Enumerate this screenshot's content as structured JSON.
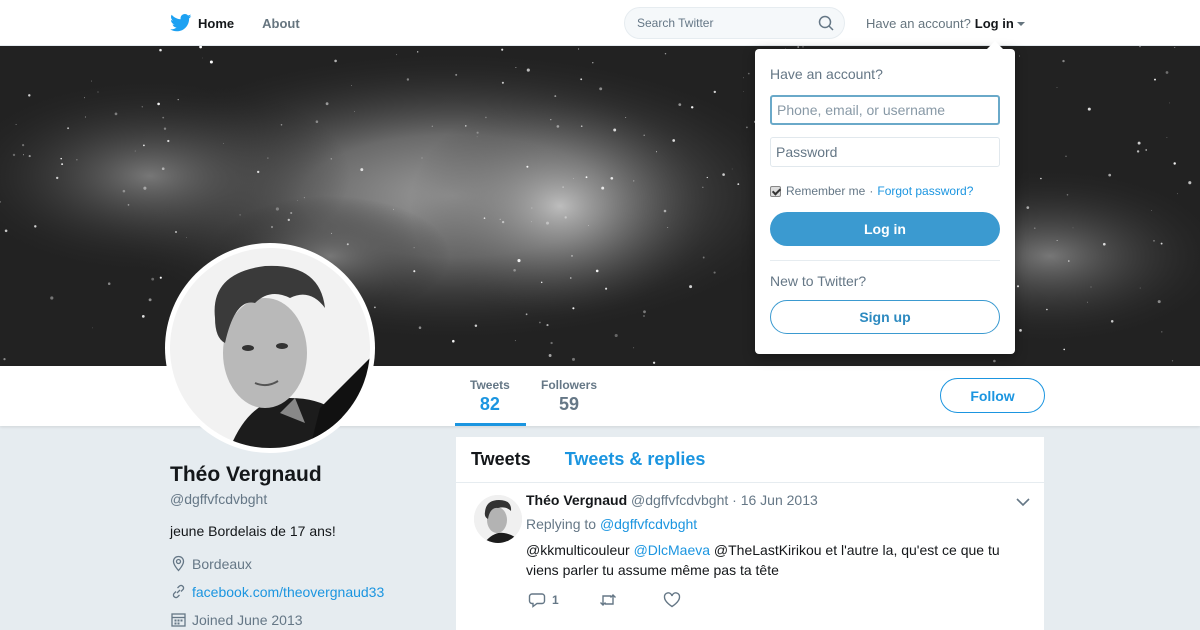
{
  "nav": {
    "home_label": "Home",
    "about_label": "About",
    "search_placeholder": "Search Twitter",
    "have_account": "Have an account?",
    "login_label": "Log in"
  },
  "profile": {
    "name": "Théo Vergnaud",
    "handle": "@dgffvfcdvbght",
    "bio": "jeune Bordelais de 17 ans!",
    "location": "Bordeaux",
    "website": "facebook.com/theovergnaud33",
    "joined": "Joined June 2013"
  },
  "stats": [
    {
      "label": "Tweets",
      "value": "82"
    },
    {
      "label": "Followers",
      "value": "59"
    }
  ],
  "follow_label": "Follow",
  "timeline": {
    "tabs": [
      "Tweets",
      "Tweets & replies"
    ],
    "tweet": {
      "name": "Théo Vergnaud",
      "handle": "@dgffvfcdvbght",
      "dot": "·",
      "date": "16 Jun 2013",
      "replying_to": "Replying to",
      "reply_handle": "@dgffvfcdvbght",
      "text_part1": "@kkmulticouleur",
      "mention": "@DlcMaeva",
      "text_part2": "@TheLastKirikou et l'autre la, qu'est ce que tu viens parler tu assume même pas ta tête",
      "reply_count": "1"
    }
  },
  "login_dropdown": {
    "title": "Have an account?",
    "username_placeholder": "Phone, email, or username",
    "password_placeholder": "Password",
    "remember": "Remember me",
    "separator": "·",
    "forgot": "Forgot password?",
    "login_button": "Log in",
    "new_to": "New to Twitter?",
    "signup_button": "Sign up"
  },
  "colors": {
    "accent": "#1b95e0",
    "login_button": "#3b9ad0"
  },
  "icons": [
    "twitter-bird-icon",
    "search-icon",
    "caret-down-icon",
    "location-icon",
    "link-icon",
    "calendar-icon",
    "reply-icon",
    "retweet-icon",
    "like-icon",
    "chevron-down-icon"
  ]
}
